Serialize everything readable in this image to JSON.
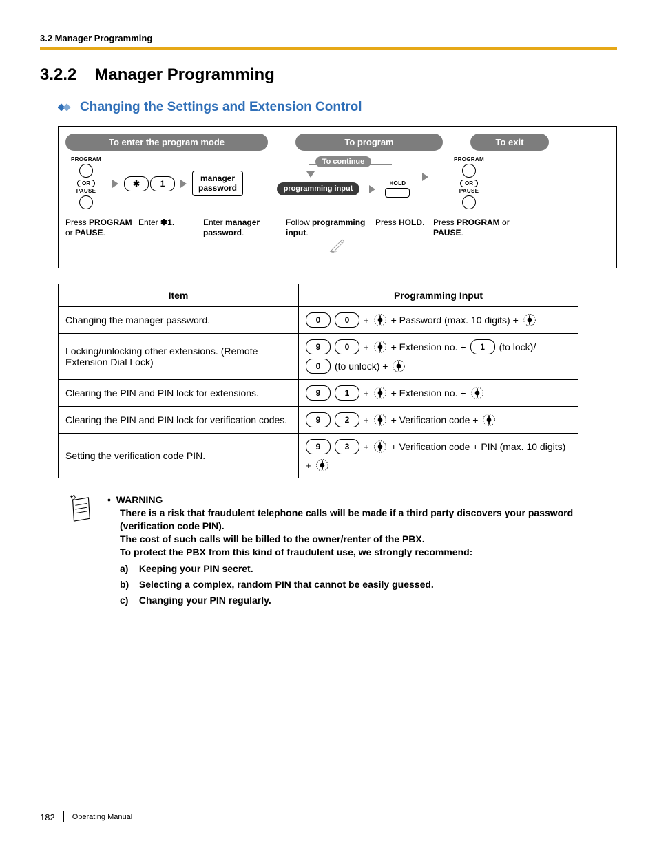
{
  "header": {
    "running": "3.2 Manager Programming"
  },
  "title": {
    "number": "3.2.2",
    "text": "Manager Programming"
  },
  "subtitle": "Changing the Settings and Extension Control",
  "flow": {
    "enter_header": "To enter the program mode",
    "program_header": "To program",
    "exit_header": "To exit",
    "continue_label": "To continue",
    "prog_input_label": "programming input",
    "program_label": "PROGRAM",
    "or_label": "OR",
    "pause_label": "PAUSE",
    "hold_label": "HOLD",
    "star_key": "✱",
    "one_key": "1",
    "mgr_pw_box_l1": "manager",
    "mgr_pw_box_l2": "password",
    "cap_enter1_a": "Press ",
    "cap_enter1_b": "PROGRAM",
    "cap_enter1_c": " or ",
    "cap_enter1_d": "PAUSE",
    "cap_enter1_e": ".",
    "cap_enter2_a": "Enter ",
    "cap_enter2_b": "✱1",
    "cap_enter2_c": ".",
    "cap_enter3_a": "Enter ",
    "cap_enter3_b": "manager password",
    "cap_enter3_c": ".",
    "cap_prog1_a": "Follow ",
    "cap_prog1_b": "programming input",
    "cap_prog1_c": ".",
    "cap_prog2_a": "Press ",
    "cap_prog2_b": "HOLD",
    "cap_prog2_c": ".",
    "cap_exit_a": "Press ",
    "cap_exit_b": "PROGRAM",
    "cap_exit_c": " or ",
    "cap_exit_d": "PAUSE",
    "cap_exit_e": "."
  },
  "table": {
    "head_item": "Item",
    "head_input": "Programming Input",
    "rows": [
      {
        "item": "Changing the manager password.",
        "keys": [
          "0",
          "0"
        ],
        "tail1": "+ Password (max. 10 digits) +",
        "tail2": "",
        "tail_extra_keys": [],
        "has_second_enter": true
      },
      {
        "item": "Locking/unlocking other extensions. (Remote Extension Dial Lock)",
        "keys": [
          "9",
          "0"
        ],
        "tail1": "+ Extension no. +",
        "tail_extra_keys": [
          "1"
        ],
        "tail2": "(to lock)/",
        "line2_keys": [
          "0"
        ],
        "line2_tail": "(to unlock) +",
        "has_second_enter": true,
        "second_enter_on_line2": true
      },
      {
        "item": "Clearing the PIN and PIN lock for extensions.",
        "keys": [
          "9",
          "1"
        ],
        "tail1": "+ Extension no. +",
        "tail2": "",
        "tail_extra_keys": [],
        "has_second_enter": true
      },
      {
        "item": "Clearing the PIN and PIN lock for verification codes.",
        "keys": [
          "9",
          "2"
        ],
        "tail1": "+ Verification code +",
        "tail2": "",
        "tail_extra_keys": [],
        "has_second_enter": true
      },
      {
        "item": "Setting the verification code PIN.",
        "keys": [
          "9",
          "3"
        ],
        "tail1": "+ Verification code + PIN (max. 10 digits)",
        "tail2": "",
        "tail_extra_keys": [],
        "line2_prefix": "+",
        "has_second_enter": true,
        "second_enter_on_line2": true
      }
    ]
  },
  "warning": {
    "bullet": "•",
    "head": "WARNING",
    "p1": "There is a risk that fraudulent telephone calls will be made if a third party discovers your password (verification code PIN).",
    "p2": "The cost of such calls will be billed to the owner/renter of the PBX.",
    "p3": "To protect the PBX from this kind of fraudulent use, we strongly recommend:",
    "items": [
      {
        "label": "a)",
        "text": "Keeping your PIN secret."
      },
      {
        "label": "b)",
        "text": "Selecting a complex, random PIN that cannot be easily guessed."
      },
      {
        "label": "c)",
        "text": "Changing your PIN regularly."
      }
    ]
  },
  "footer": {
    "page": "182",
    "doc": "Operating Manual"
  }
}
